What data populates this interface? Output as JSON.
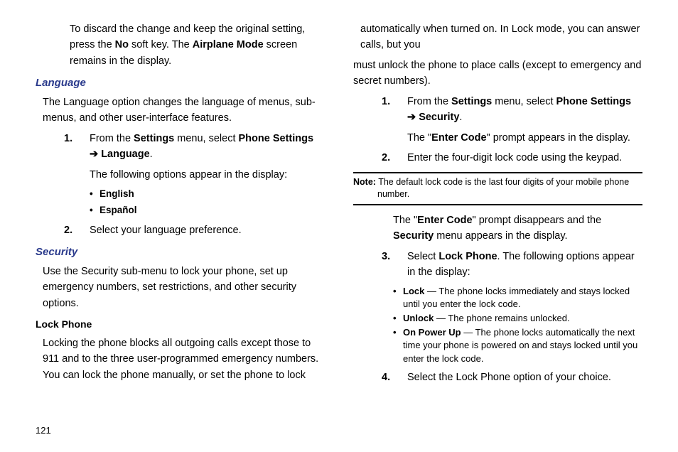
{
  "pageNumber": "121",
  "col1": {
    "discardPara_pre": "To discard the change and keep the original setting, press the ",
    "discardPara_no": "No",
    "discardPara_mid": " soft key. The ",
    "discardPara_am": "Airplane Mode",
    "discardPara_post": " screen remains in the display.",
    "languageHead": "Language",
    "languageIntro": "The Language option changes the language of menus, sub-menus, and other user-interface features.",
    "langStep1_pre": "From the ",
    "langStep1_settings": "Settings",
    "langStep1_mid": " menu, select ",
    "langStep1_ps": "Phone Settings",
    "langStep1_arrow": " ➔ ",
    "langStep1_lang": "Language",
    "langStep1_post": ".",
    "langStep1_sub": "The following options appear in the display:",
    "langOpt1": "English",
    "langOpt2": "Español",
    "langStep2": "Select your language preference.",
    "securityHead": "Security",
    "securityIntro": "Use the Security sub-menu to lock your phone, set up emergency numbers, set restrictions, and other security options.",
    "lockPhoneHead": "Lock Phone",
    "lockIntro": "Locking the phone blocks all outgoing calls except those to 911 and to the three user-programmed emergency numbers. You can lock the phone manually, or set the phone to lock automatically when turned on. In Lock mode, you can answer calls, but you"
  },
  "col2": {
    "lockIntroCont": "must unlock the phone to place calls (except to emergency and secret numbers).",
    "lockStep1_pre": "From the ",
    "lockStep1_settings": "Settings",
    "lockStep1_mid": " menu, select ",
    "lockStep1_ps": "Phone Settings",
    "lockStep1_arrow": " ➔ ",
    "lockStep1_sec": "Security",
    "lockStep1_post": ".",
    "lockStep1_sub_pre": "The \"",
    "lockStep1_sub_ec": "Enter Code",
    "lockStep1_sub_post": "\" prompt appears in the display.",
    "lockStep2": "Enter the four-digit lock code using the keypad.",
    "noteLabel": "Note:",
    "noteText": " The default lock code is the last four digits of your mobile phone number.",
    "afterNote_pre": "The \"",
    "afterNote_ec": "Enter Code",
    "afterNote_mid": "\" prompt disappears and the ",
    "afterNote_sec": "Security",
    "afterNote_post": " menu appears in the display.",
    "lockStep3_pre": "Select ",
    "lockStep3_lp": "Lock Phone",
    "lockStep3_post": ". The following options appear in the display:",
    "opt1_b": "Lock",
    "opt1_t": " — The phone locks immediately and stays locked until you enter the lock code.",
    "opt2_b": "Unlock",
    "opt2_t": " — The phone remains unlocked.",
    "opt3_b": "On Power Up",
    "opt3_t": " — The phone locks automatically the next time your phone is powered on and stays locked until you enter the lock code.",
    "lockStep4": "Select the Lock Phone option of your choice."
  }
}
